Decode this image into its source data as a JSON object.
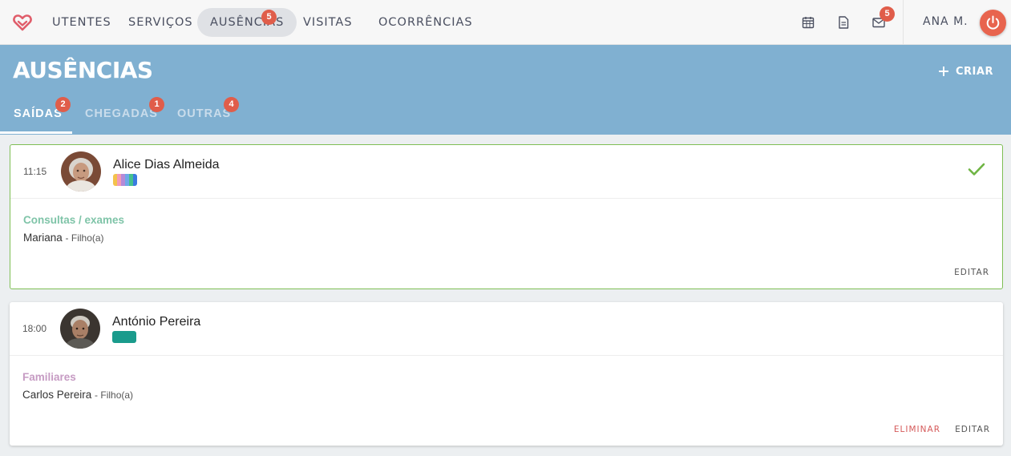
{
  "nav": {
    "items": [
      {
        "label": "UTENTES"
      },
      {
        "label": "SERVIÇOS"
      },
      {
        "label": "AUSÊNCIAS",
        "badge": "5",
        "active": true
      },
      {
        "label": "VISITAS"
      },
      {
        "label": "OCORRÊNCIAS"
      }
    ],
    "messages_badge": "5",
    "user_name": "ANA M."
  },
  "header": {
    "title": "AUSÊNCIAS",
    "create_label": "CRIAR",
    "tabs": [
      {
        "label": "SAÍDAS",
        "badge": "2",
        "active": true
      },
      {
        "label": "CHEGADAS",
        "badge": "1"
      },
      {
        "label": "OUTRAS",
        "badge": "4"
      }
    ]
  },
  "absences": [
    {
      "time": "11:15",
      "name": "Alice Dias Almeida",
      "tag_colors": [
        "#f4c24b",
        "#f29ab7",
        "#b48ad8",
        "#6fa8e8",
        "#45c18e",
        "#3a7be0"
      ],
      "category": "Consultas / exames",
      "category_color": "#7fc4a8",
      "companion": "Mariana",
      "relation": "- Filho(a)",
      "confirmed": true,
      "actions": {
        "edit": "EDITAR"
      }
    },
    {
      "time": "18:00",
      "name": "António Pereira",
      "tag_colors": [
        "#1a9b8c"
      ],
      "category": "Familiares",
      "category_color": "#c69bc3",
      "companion": "Carlos Pereira",
      "relation": "- Filho(a)",
      "confirmed": false,
      "actions": {
        "delete": "ELIMINAR",
        "edit": "EDITAR"
      }
    }
  ],
  "colors": {
    "accent": "#80b0d1",
    "badge": "#e05d4a",
    "confirm": "#7fbf55",
    "power": "#e8644e"
  }
}
